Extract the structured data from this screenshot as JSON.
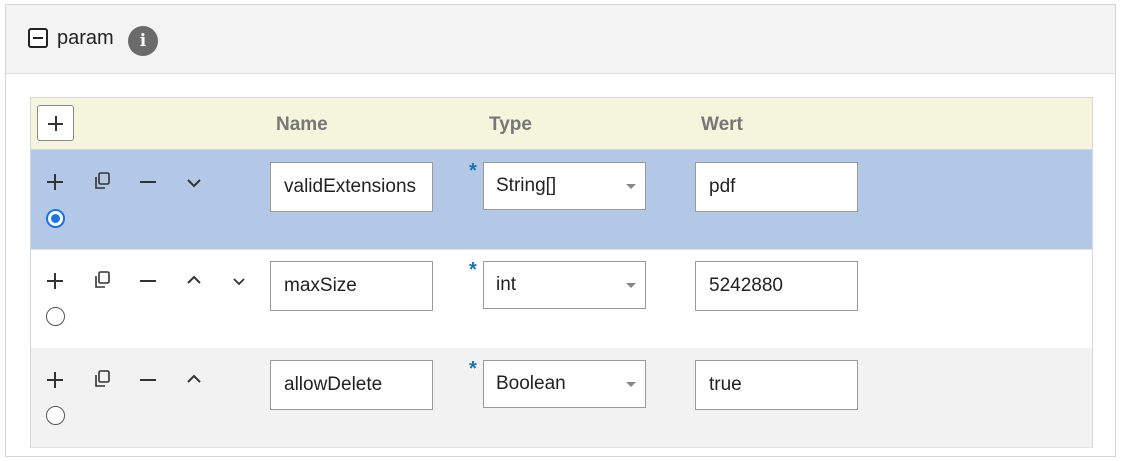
{
  "panel": {
    "title": "param",
    "info_icon": "i"
  },
  "table": {
    "columns": {
      "name": "Name",
      "type": "Type",
      "value": "Wert"
    },
    "required_mark": "*",
    "rows": [
      {
        "name": "validExtensions",
        "type": "String[]",
        "value": "pdf",
        "selected": true
      },
      {
        "name": "maxSize",
        "type": "int",
        "value": "5242880",
        "selected": false
      },
      {
        "name": "allowDelete",
        "type": "Boolean",
        "value": "true",
        "selected": false
      }
    ]
  },
  "colors": {
    "selected_row": "#b3c8e6",
    "header_bg": "#f5f5dd",
    "alt_row": "#f2f2f2",
    "accent": "#1a73e8"
  }
}
